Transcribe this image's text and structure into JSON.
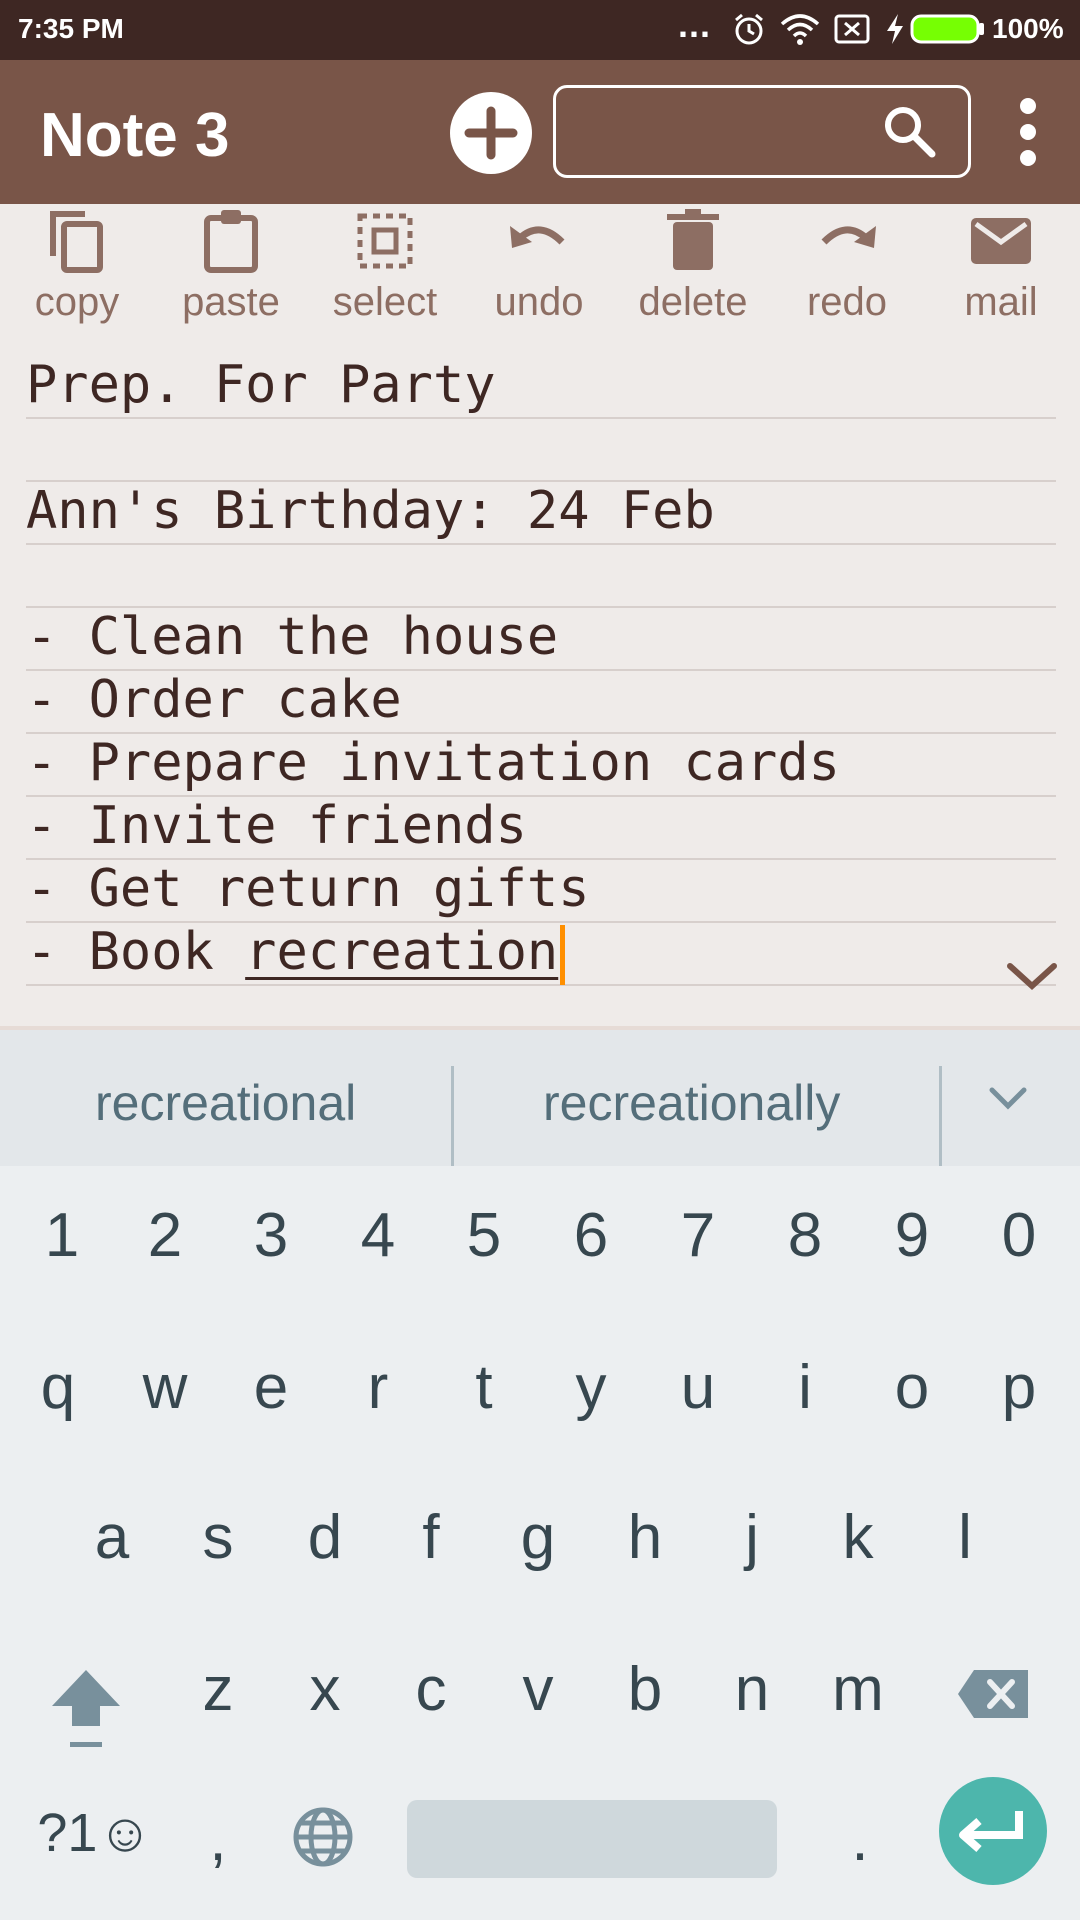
{
  "status_bar": {
    "time": "7:35 PM",
    "dots": "...",
    "battery_pct": "100%",
    "battery_color": "#76ff03"
  },
  "app_bar": {
    "title": "Note 3",
    "add_icon": "plus-circle-icon",
    "search_icon": "search-icon",
    "overflow_icon": "more-vert-icon",
    "color": "#795548"
  },
  "toolbar": {
    "copy": "copy",
    "paste": "paste",
    "select": "select",
    "undo": "undo",
    "delete": "delete",
    "redo": "redo",
    "mail": "mail"
  },
  "note": {
    "lines": [
      "Prep. For Party",
      "",
      "Ann's Birthday: 24 Feb",
      "",
      "- Clean the house",
      "- Order cake",
      "- Prepare invitation cards",
      "- Invite friends",
      "- Get return gifts"
    ],
    "last_line_prefix": "- Book ",
    "last_line_word": "recreation",
    "cursor_color": "#ff8f00"
  },
  "suggestions": {
    "first": "recreational",
    "second": "recreationally"
  },
  "keyboard": {
    "numbers": [
      "1",
      "2",
      "3",
      "4",
      "5",
      "6",
      "7",
      "8",
      "9",
      "0"
    ],
    "row1": [
      "q",
      "w",
      "e",
      "r",
      "t",
      "y",
      "u",
      "i",
      "o",
      "p"
    ],
    "row2": [
      "a",
      "s",
      "d",
      "f",
      "g",
      "h",
      "j",
      "k",
      "l"
    ],
    "row3": [
      "z",
      "x",
      "c",
      "v",
      "b",
      "n",
      "m"
    ],
    "symbols_key": "?1☺",
    "comma_key": ",",
    "period_key": ".",
    "enter_color": "#4db6ac"
  }
}
